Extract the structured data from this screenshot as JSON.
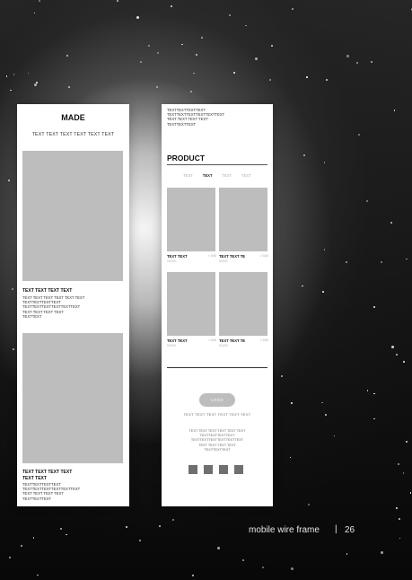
{
  "left_frame": {
    "title": "MADE",
    "subtitle": "TEXT TEXT TEXT TEXT TEXT TEXT",
    "caption1": {
      "heading": "TEXT TEXT TEXT TEXT",
      "lines": [
        "TEXT TEXT TEXT TEXT TEXT TEXT",
        "TEXTTEXTTEXTTEXT",
        "TEXTTEXTTEXTTEXTTEXTTEXT",
        "TEXT TEXT TEXT TEXT",
        "TEXTTEXT"
      ]
    },
    "caption2": {
      "heading_lines": [
        "TEXT TEXT TEXT TEXT",
        "TEXT TEXT"
      ],
      "lines": [
        "TEXTTEXTTEXTTEXT",
        "TEXTTEXTTEXTTEXTTEXTTEXT",
        "TEXT TEXT TEXT TEXT",
        "TEXTTEXTTEXT"
      ]
    }
  },
  "right_frame": {
    "top_lines": [
      "TEXTTEXTTEXTTEXT",
      "TEXTTEXTTEXTTEXTTEXTTEXT",
      "TEXT TEXT TEXT TEXT",
      "TEXTTEXTTEXT"
    ],
    "product_title": "PRODUCT",
    "tabs": [
      {
        "label": "TEXT",
        "active": false
      },
      {
        "label": "TEXT",
        "active": true
      },
      {
        "label": "TEXT",
        "active": false
      },
      {
        "label": "TEXT",
        "active": false
      }
    ],
    "products": [
      {
        "name": "TEXT TEXT",
        "price": "00,000",
        "arrow": "> 0,00"
      },
      {
        "name": "TEXT TEXT TE",
        "price": "00,000",
        "arrow": "> 0,00"
      },
      {
        "name": "TEXT TEXT",
        "price": "00,000",
        "arrow": "> 0,00"
      },
      {
        "name": "TEXT TEXT TE",
        "price": "00,000",
        "arrow": "> 0,00"
      }
    ],
    "logo_label": "LOGO",
    "footer_nav": "TEXT TEXT TEXT TEXT TEXT TEXT",
    "footer_lines": [
      "TEXT TEXT TEXT TEXT TEXT TEXT",
      "TEXTTEXTTEXTTEXT",
      "TEXTTEXTTEXTTEXTTEXTTEXT",
      "TEXT TEXT TEXT TEXT",
      "TEXTTEXTTEXT"
    ],
    "social_icons": [
      "social-icon-1",
      "social-icon-2",
      "social-icon-3",
      "social-icon-4"
    ]
  },
  "page": {
    "label": "mobile wire frame",
    "separator": "|",
    "number": "26"
  },
  "colors": {
    "placeholder_gray": "#bdbdbd",
    "social_gray": "#6f6f6f",
    "frame_white": "#ffffff"
  }
}
